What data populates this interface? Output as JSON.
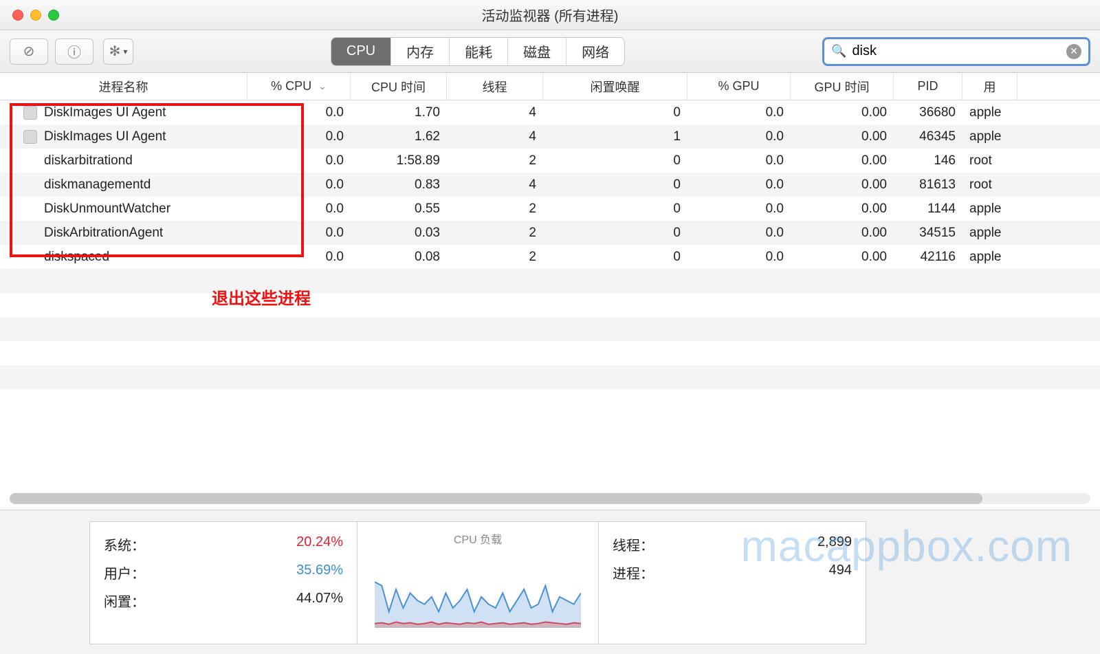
{
  "window": {
    "title": "活动监视器 (所有进程)"
  },
  "toolbar": {
    "tabs": [
      "CPU",
      "内存",
      "能耗",
      "磁盘",
      "网络"
    ],
    "active_tab_index": 0,
    "search_value": "disk"
  },
  "columns": [
    {
      "key": "name",
      "label": "进程名称"
    },
    {
      "key": "cpu",
      "label": "% CPU",
      "sorted": true
    },
    {
      "key": "cput",
      "label": "CPU 时间"
    },
    {
      "key": "threads",
      "label": "线程"
    },
    {
      "key": "wake",
      "label": "闲置唤醒"
    },
    {
      "key": "gpu",
      "label": "% GPU"
    },
    {
      "key": "gput",
      "label": "GPU 时间"
    },
    {
      "key": "pid",
      "label": "PID"
    },
    {
      "key": "user",
      "label": "用"
    }
  ],
  "processes": [
    {
      "icon": true,
      "name": "DiskImages UI Agent",
      "cpu": "0.0",
      "cput": "1.70",
      "threads": "4",
      "wake": "0",
      "gpu": "0.0",
      "gput": "0.00",
      "pid": "36680",
      "user": "apple"
    },
    {
      "icon": true,
      "name": "DiskImages UI Agent",
      "cpu": "0.0",
      "cput": "1.62",
      "threads": "4",
      "wake": "1",
      "gpu": "0.0",
      "gput": "0.00",
      "pid": "46345",
      "user": "apple"
    },
    {
      "icon": false,
      "name": "diskarbitrationd",
      "cpu": "0.0",
      "cput": "1:58.89",
      "threads": "2",
      "wake": "0",
      "gpu": "0.0",
      "gput": "0.00",
      "pid": "146",
      "user": "root"
    },
    {
      "icon": false,
      "name": "diskmanagementd",
      "cpu": "0.0",
      "cput": "0.83",
      "threads": "4",
      "wake": "0",
      "gpu": "0.0",
      "gput": "0.00",
      "pid": "81613",
      "user": "root"
    },
    {
      "icon": false,
      "name": "DiskUnmountWatcher",
      "cpu": "0.0",
      "cput": "0.55",
      "threads": "2",
      "wake": "0",
      "gpu": "0.0",
      "gput": "0.00",
      "pid": "1144",
      "user": "apple"
    },
    {
      "icon": false,
      "name": "DiskArbitrationAgent",
      "cpu": "0.0",
      "cput": "0.03",
      "threads": "2",
      "wake": "0",
      "gpu": "0.0",
      "gput": "0.00",
      "pid": "34515",
      "user": "apple"
    },
    {
      "icon": false,
      "name": "diskspaced",
      "cpu": "0.0",
      "cput": "0.08",
      "threads": "2",
      "wake": "0",
      "gpu": "0.0",
      "gput": "0.00",
      "pid": "42116",
      "user": "apple"
    }
  ],
  "annotation": {
    "text": "退出这些进程"
  },
  "footer": {
    "left": {
      "system_label": "系统：",
      "system_value": "20.24%",
      "user_label": "用户：",
      "user_value": "35.69%",
      "idle_label": "闲置：",
      "idle_value": "44.07%"
    },
    "mid": {
      "title": "CPU 负载"
    },
    "right": {
      "threads_label": "线程：",
      "threads_value": "2,899",
      "processes_label": "进程：",
      "processes_value": "494"
    }
  },
  "watermark": "macappbox.com",
  "chart_data": {
    "type": "area",
    "title": "CPU 负载",
    "x": [
      0,
      1,
      2,
      3,
      4,
      5,
      6,
      7,
      8,
      9,
      10,
      11,
      12,
      13,
      14,
      15,
      16,
      17,
      18,
      19,
      20,
      21,
      22,
      23,
      24,
      25,
      26,
      27,
      28,
      29
    ],
    "series": [
      {
        "name": "系统 (red)",
        "values": [
          4,
          5,
          3,
          6,
          4,
          5,
          3,
          4,
          6,
          3,
          5,
          4,
          3,
          5,
          4,
          6,
          3,
          4,
          5,
          3,
          4,
          5,
          3,
          4,
          6,
          5,
          4,
          3,
          5,
          4
        ]
      },
      {
        "name": "用户 (blue)",
        "values": [
          60,
          55,
          20,
          50,
          25,
          45,
          35,
          30,
          40,
          20,
          45,
          25,
          35,
          50,
          20,
          40,
          30,
          25,
          45,
          20,
          35,
          50,
          25,
          30,
          55,
          20,
          40,
          35,
          30,
          45
        ]
      }
    ],
    "ylim": [
      0,
      100
    ],
    "xlabel": "",
    "ylabel": ""
  }
}
